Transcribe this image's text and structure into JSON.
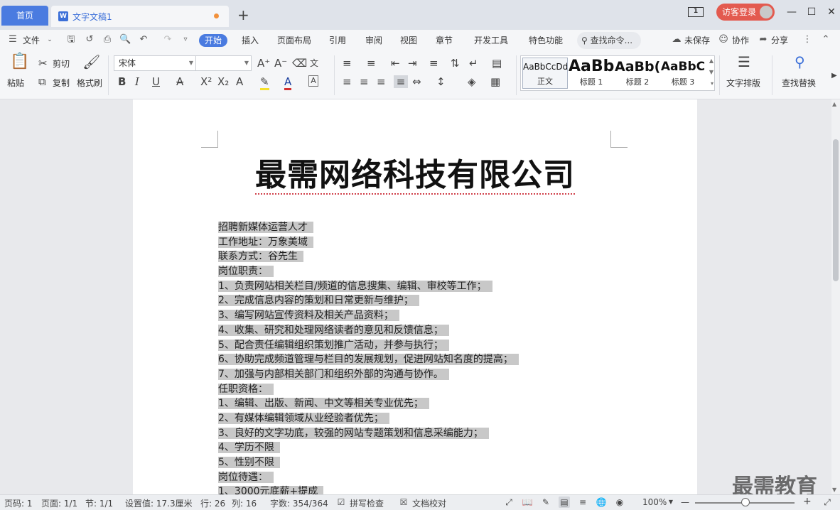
{
  "titlebar": {
    "home_tab": "首页",
    "doc_tab_icon": "W",
    "doc_tab": "文字文稿1",
    "add_tab": "+",
    "window_count": "1",
    "login": "访客登录"
  },
  "menubar": {
    "file": "文件",
    "tabs": [
      "开始",
      "插入",
      "页面布局",
      "引用",
      "审阅",
      "视图",
      "章节",
      "开发工具",
      "特色功能"
    ],
    "search": "查找命令...",
    "unsaved": "未保存",
    "collab": "协作",
    "share": "分享"
  },
  "ribbon": {
    "paste": "粘贴",
    "cut": "剪切",
    "copy": "复制",
    "format_painter": "格式刷",
    "font_name": "宋体",
    "font_size": "",
    "styles": [
      {
        "sample": "AaBbCcDd",
        "name": "正文"
      },
      {
        "sample": "AaBb",
        "name": "标题 1"
      },
      {
        "sample": "AaBb(",
        "name": "标题 2"
      },
      {
        "sample": "AaBbC",
        "name": "标题 3"
      }
    ],
    "text_layout": "文字排版",
    "find_replace": "查找替换"
  },
  "document": {
    "title": "最需网络科技有限公司",
    "lines": [
      "招聘新媒体运营人才",
      "工作地址：万象美域",
      "联系方式：谷先生",
      "岗位职责：",
      "1、负责网站相关栏目/频道的信息搜集、编辑、审校等工作；",
      "2、完成信息内容的策划和日常更新与维护；",
      "3、编写网站宣传资料及相关产品资料；",
      "4、收集、研究和处理网络读者的意见和反馈信息；",
      "5、配合责任编辑组织策划推广活动，并参与执行；",
      "6、协助完成频道管理与栏目的发展规划，促进网站知名度的提高；",
      "7、加强与内部相关部门和组织外部的沟通与协作。",
      "任职资格：",
      "1、编辑、出版、新闻、中文等相关专业优先；",
      "2、有媒体编辑领域从业经验者优先；",
      "3、良好的文字功底，较强的网站专题策划和信息采编能力；",
      "4、学历不限",
      "5、性别不限",
      "岗位待遇：",
      "1、3000元底薪+提成"
    ]
  },
  "watermark": "最需教育",
  "statusbar": {
    "page_no": "页码: 1",
    "pages": "页面: 1/1",
    "section": "节: 1/1",
    "setting": "设置值: 17.3厘米",
    "row": "行: 26",
    "col": "列: 16",
    "words": "字数: 354/364",
    "spell": "拼写检查",
    "proof": "文档校对",
    "zoom": "100%",
    "zoom_minus": "—",
    "zoom_plus": "+"
  }
}
